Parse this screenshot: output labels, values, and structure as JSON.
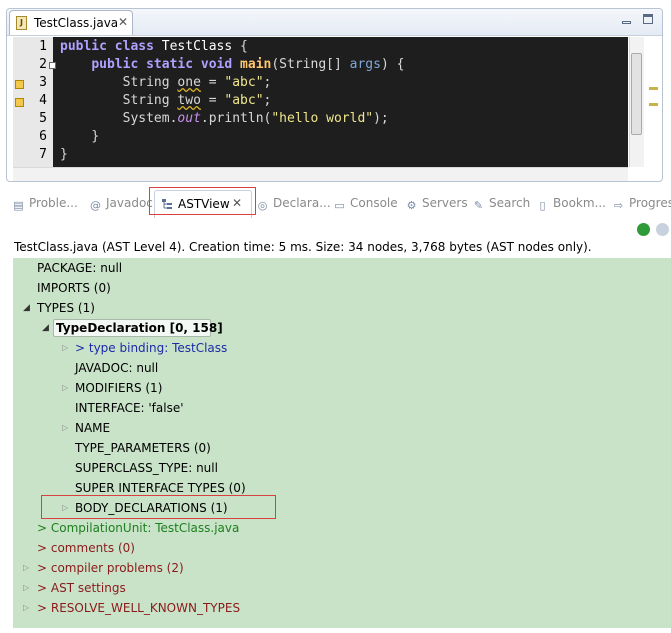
{
  "editor": {
    "tab_label": "TestClass.java",
    "lines": [
      {
        "num": "1"
      },
      {
        "num": "2"
      },
      {
        "num": "3"
      },
      {
        "num": "4"
      },
      {
        "num": "5"
      },
      {
        "num": "6"
      },
      {
        "num": "7"
      }
    ],
    "code": {
      "l1_kw1": "public",
      "l1_kw2": "class",
      "l1_name": "TestClass",
      "l1_brace": "{",
      "l2_kw1": "public",
      "l2_kw2": "static",
      "l2_kw3": "void",
      "l2_method": "main",
      "l2_paren": "(String[] ",
      "l2_param": "args",
      "l2_end": ") {",
      "l3_type": "String ",
      "l3_var": "one",
      "l3_eq": " = ",
      "l3_str": "\"abc\"",
      "l3_end": ";",
      "l4_type": "String ",
      "l4_var": "two",
      "l4_eq": " = ",
      "l4_str": "\"abc\"",
      "l4_end": ";",
      "l5_obj": "System.",
      "l5_field": "out",
      "l5_call": ".println(",
      "l5_str": "\"hello world\"",
      "l5_end": ");",
      "l6": "}",
      "l7": "}"
    }
  },
  "views": {
    "tabs": [
      {
        "label": "Proble...",
        "icon": "problems-icon"
      },
      {
        "label": "Javadoc",
        "icon": "javadoc-icon"
      },
      {
        "label": "ASTView",
        "icon": "astview-icon",
        "active": true
      },
      {
        "label": "Declara...",
        "icon": "declaration-icon"
      },
      {
        "label": "Console",
        "icon": "console-icon"
      },
      {
        "label": "Servers",
        "icon": "servers-icon"
      },
      {
        "label": "Search",
        "icon": "search-icon"
      },
      {
        "label": "Bookm...",
        "icon": "bookmarks-icon"
      },
      {
        "label": "Progres",
        "icon": "progress-icon"
      }
    ],
    "highlight_color": "#d94040"
  },
  "ast": {
    "info": "TestClass.java (AST Level 4).  Creation time: 5 ms.  Size: 34 nodes, 3,768 bytes (AST nodes only).",
    "tree": {
      "package": "PACKAGE: null",
      "imports": "IMPORTS (0)",
      "types": "TYPES (1)",
      "type_decl": "TypeDeclaration",
      "type_decl_range": "[0, 158]",
      "type_binding": "> type binding: TestClass",
      "javadoc": "JAVADOC: null",
      "modifiers": "MODIFIERS (1)",
      "interface": "INTERFACE: 'false'",
      "name": "NAME",
      "type_params": "TYPE_PARAMETERS (0)",
      "superclass": "SUPERCLASS_TYPE: null",
      "super_ifaces": "SUPER INTERFACE TYPES (0)",
      "body_decls": "BODY_DECLARATIONS (1)",
      "compilation_unit": "> CompilationUnit: TestClass.java",
      "comments": "> comments (0)",
      "compiler_problems": "> compiler problems (2)",
      "ast_settings": "> AST settings",
      "resolve": "> RESOLVE_WELL_KNOWN_TYPES"
    },
    "bg_color": "#c9e3c9"
  }
}
